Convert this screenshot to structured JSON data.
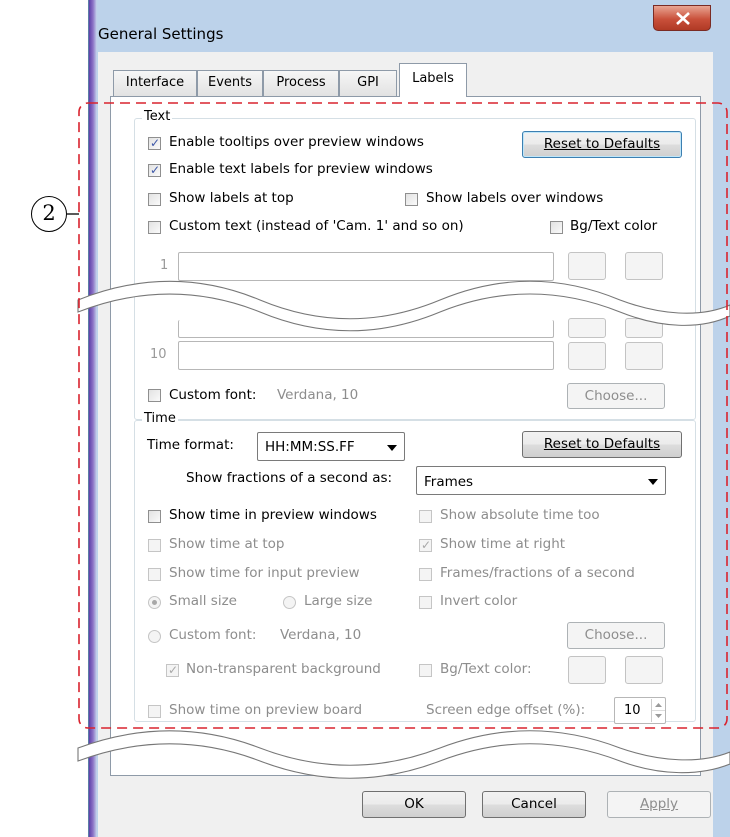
{
  "window": {
    "title": "General Settings"
  },
  "tabs": [
    {
      "label": "Interface"
    },
    {
      "label": "Events"
    },
    {
      "label": "Process"
    },
    {
      "label": "GPI"
    },
    {
      "label": "Labels",
      "active": true
    }
  ],
  "text_group": {
    "label": "Text",
    "enable_tooltips": {
      "label": "Enable tooltips over preview windows",
      "checked": true
    },
    "enable_text_labels": {
      "label": "Enable text labels for preview windows",
      "checked": true
    },
    "show_labels_at_top": {
      "label": "Show labels at top",
      "checked": false
    },
    "show_labels_over_windows": {
      "label": "Show labels over windows",
      "checked": false
    },
    "custom_text": {
      "label": "Custom text (instead of 'Cam. 1' and so on)",
      "checked": false
    },
    "bg_text_color": {
      "label": "Bg/Text color",
      "checked": false
    },
    "reset_button": "Reset to Defaults",
    "rows": [
      {
        "number": "1"
      },
      {
        "number": "10"
      }
    ],
    "custom_font": {
      "label": "Custom font:",
      "value": "Verdana, 10",
      "checked": false
    },
    "choose_button": "Choose..."
  },
  "time_group": {
    "label": "Time",
    "time_format_label": "Time format:",
    "time_format_value": "HH:MM:SS.FF",
    "reset_button": "Reset to Defaults",
    "fractions_label": "Show fractions of a second as:",
    "fractions_value": "Frames",
    "show_time_in_preview": {
      "label": "Show time in preview windows",
      "checked": false
    },
    "show_absolute_time": {
      "label": "Show absolute time too",
      "checked": false
    },
    "show_time_at_top": {
      "label": "Show time at top",
      "checked": false
    },
    "show_time_at_right": {
      "label": "Show time at right",
      "checked": true
    },
    "show_time_for_input": {
      "label": "Show time for input preview",
      "checked": false
    },
    "frames_fractions": {
      "label": "Frames/fractions of a second",
      "checked": false
    },
    "small_size": {
      "label": "Small size",
      "selected": true
    },
    "large_size": {
      "label": "Large size",
      "selected": false
    },
    "invert_color": {
      "label": "Invert color",
      "checked": false
    },
    "custom_font": {
      "label": "Custom font:",
      "value": "Verdana, 10",
      "selected": false
    },
    "choose_button": "Choose...",
    "non_transparent_bg": {
      "label": "Non-transparent background",
      "checked": true
    },
    "bg_text_color": {
      "label": "Bg/Text color:",
      "checked": false
    },
    "show_time_on_board": {
      "label": "Show time on preview board",
      "checked": false
    },
    "edge_offset_label": "Screen edge offset (%):",
    "edge_offset_value": "10"
  },
  "footer": {
    "ok": "OK",
    "cancel": "Cancel",
    "apply": "Apply"
  },
  "annotation": {
    "marker": "2"
  },
  "colors": {
    "accent": "#3c7fb1",
    "annotation_dash": "#d9232e",
    "checkmark": "#3e58a8",
    "disabled_text": "#8d8d8d"
  }
}
